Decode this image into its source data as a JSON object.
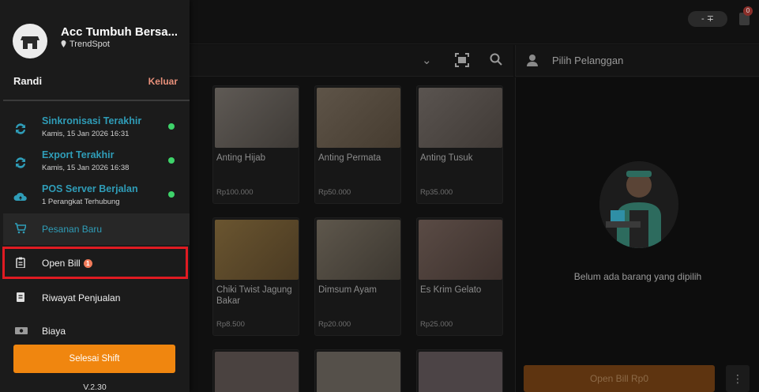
{
  "header": {
    "pill_text": "- ∓",
    "notification_count": "0"
  },
  "customer": {
    "label": "Pilih Pelanggan"
  },
  "products": [
    {
      "name": "",
      "price": ""
    },
    {
      "name": "Anting Hijab",
      "price": "Rp100.000"
    },
    {
      "name": "Anting Permata",
      "price": "Rp50.000"
    },
    {
      "name": "Anting Tusuk",
      "price": "Rp35.000"
    },
    {
      "name": "",
      "price": ""
    },
    {
      "name": "Chiki Twist Jagung Bakar",
      "price": "Rp8.500"
    },
    {
      "name": "Dimsum Ayam",
      "price": "Rp20.000"
    },
    {
      "name": "Es Krim Gelato",
      "price": "Rp25.000"
    }
  ],
  "cart": {
    "empty_text": "Belum ada barang yang dipilih",
    "open_bill_label": "Open Bill Rp0",
    "more_label": "⋮"
  },
  "drawer": {
    "store_name": "Acc Tumbuh Bersa...",
    "branch": "TrendSpot",
    "user": "Randi",
    "logout": "Keluar",
    "statuses": [
      {
        "title": "Sinkronisasi Terakhir",
        "sub": "Kamis, 15 Jan 2026 16:31"
      },
      {
        "title": "Export Terakhir",
        "sub": "Kamis, 15 Jan 2026 16:38"
      },
      {
        "title": "POS Server Berjalan",
        "sub": "1 Perangkat Terhubung"
      }
    ],
    "menu": {
      "new_order": "Pesanan Baru",
      "open_bill": "Open Bill",
      "open_bill_badge": "1",
      "sales_history": "Riwayat Penjualan",
      "expenses": "Biaya"
    },
    "end_shift": "Selesai Shift",
    "version": "V.2.30"
  },
  "colors": {
    "accent_orange": "#f0860f",
    "status_blue": "#2f9db8",
    "online_green": "#3ed36a",
    "highlight_red": "#e01b22",
    "logout_text": "#e8907a"
  }
}
